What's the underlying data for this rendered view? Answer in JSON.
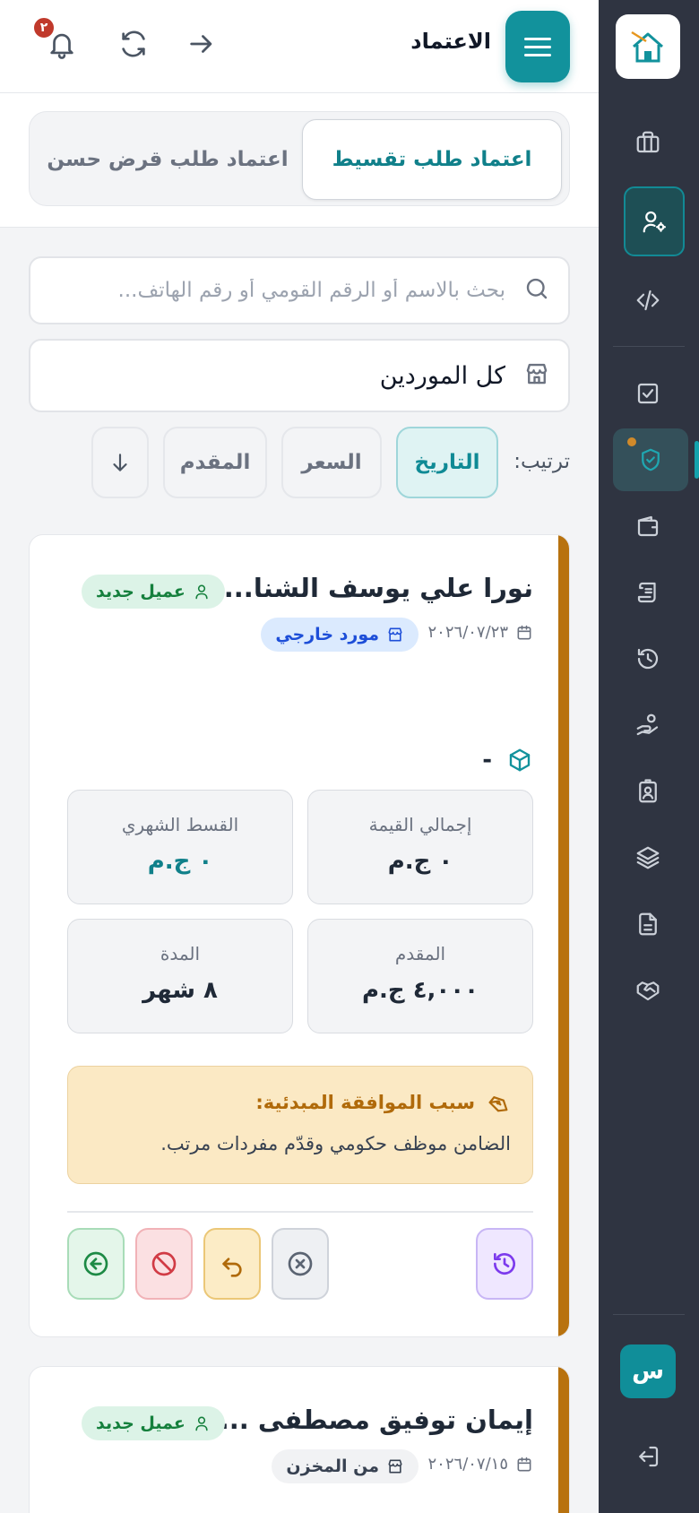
{
  "header": {
    "title": "الاعتماد",
    "notification_count": "٢"
  },
  "tabs": [
    {
      "label": "اعتماد طلب تقسيط",
      "active": true
    },
    {
      "label": "اعتماد طلب قرض حسن",
      "active": false
    }
  ],
  "search": {
    "placeholder": "بحث بالاسم أو الرقم القومي أو رقم الهاتف..."
  },
  "supplier_filter": {
    "value": "كل الموردين"
  },
  "sort": {
    "label": "ترتيب:",
    "options": [
      "التاريخ",
      "السعر",
      "المقدم"
    ],
    "active": "التاريخ",
    "direction": "descending"
  },
  "sidebar": {
    "user_initial": "س",
    "items": [
      "briefcase",
      "user-gear",
      "code",
      "check-square",
      "shield-check",
      "wallet",
      "scroll",
      "history",
      "handshake-money",
      "badge",
      "layers",
      "document",
      "handshake"
    ]
  },
  "cards": [
    {
      "name": "نورا علي يوسف الشنا...",
      "client_badge": "عميل جديد",
      "date": "٢٠٢٦/٠٧/٢٣",
      "supplier_badge": "مورد خارجي",
      "product": "-",
      "stats": {
        "total_label": "إجمالي القيمة",
        "total_value": "٠ ج.م",
        "monthly_label": "القسط الشهري",
        "monthly_value": "٠ ج.م",
        "down_label": "المقدم",
        "down_value": "٤,٠٠٠ ج.م",
        "duration_label": "المدة",
        "duration_value": "٨ شهر"
      },
      "reason_title": "سبب الموافقة المبدئية:",
      "reason_text": "الضامن موظف حكومي وقدّم مفردات مرتب."
    },
    {
      "name": "إيمان توفيق مصطفى ...",
      "client_badge": "عميل جديد",
      "date": "٢٠٢٦/٠٧/١٥",
      "supplier_badge": "من المخزن"
    }
  ],
  "colors": {
    "brand": "#12929c",
    "sidebar_bg": "#2f3441",
    "card_accent": "#b8720f"
  }
}
